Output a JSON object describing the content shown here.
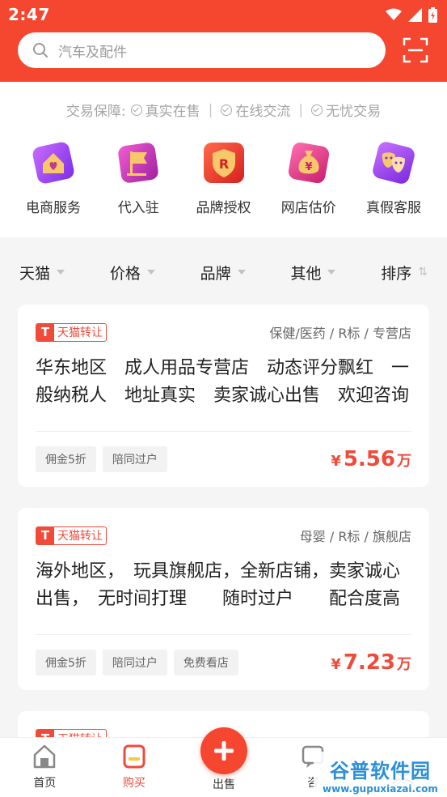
{
  "status_bar": {
    "time": "2:47"
  },
  "search": {
    "placeholder": "汽车及配件"
  },
  "guarantee": {
    "label": "交易保障:",
    "items": [
      "真实在售",
      "在线交流",
      "无忧交易"
    ]
  },
  "services": [
    {
      "label": "电商服务",
      "icon": "house-heart-icon",
      "color": "#9a3ff0"
    },
    {
      "label": "代入驻",
      "icon": "flag-icon",
      "color": "#c23aa8"
    },
    {
      "label": "品牌授权",
      "icon": "brand-r-shield-icon",
      "color": "#e8352b"
    },
    {
      "label": "网店估价",
      "icon": "money-bag-icon",
      "color": "#e23a8f"
    },
    {
      "label": "真假客服",
      "icon": "masks-icon",
      "color": "#9b44e6"
    }
  ],
  "filters": [
    {
      "label": "天猫"
    },
    {
      "label": "价格"
    },
    {
      "label": "品牌"
    },
    {
      "label": "其他"
    },
    {
      "label": "排序"
    }
  ],
  "listings": [
    {
      "badge": "天猫转让",
      "category": "保健/医药 / R标 / 专营店",
      "title": "华东地区　成人用品专营店　动态评分飘红　一般纳税人　地址真实　卖家诚心出售　欢迎咨询",
      "tags": [
        "佣金5折",
        "陪同过户"
      ],
      "price_symbol": "¥",
      "price": "5.56",
      "price_unit": "万"
    },
    {
      "badge": "天猫转让",
      "category": "母婴 / R标 / 旗舰店",
      "title": "海外地区，　玩具旗舰店，全新店铺，卖家诚心出售，　无时间打理　　随时过户　　配合度高",
      "tags": [
        "佣金5折",
        "陪同过户",
        "免费看店"
      ],
      "price_symbol": "¥",
      "price": "7.23",
      "price_unit": "万"
    },
    {
      "badge": "天猫转让",
      "category": "",
      "title": "",
      "tags": []
    }
  ],
  "bottom_nav": {
    "home": "首页",
    "buy": "购买",
    "sell": "出售",
    "consult": "咨",
    "mine": ""
  },
  "watermark": {
    "name": "谷普软件园",
    "url": "www.gupuxiazai.com"
  },
  "colors": {
    "primary": "#f5462f",
    "accent_red": "#f04a3a"
  }
}
